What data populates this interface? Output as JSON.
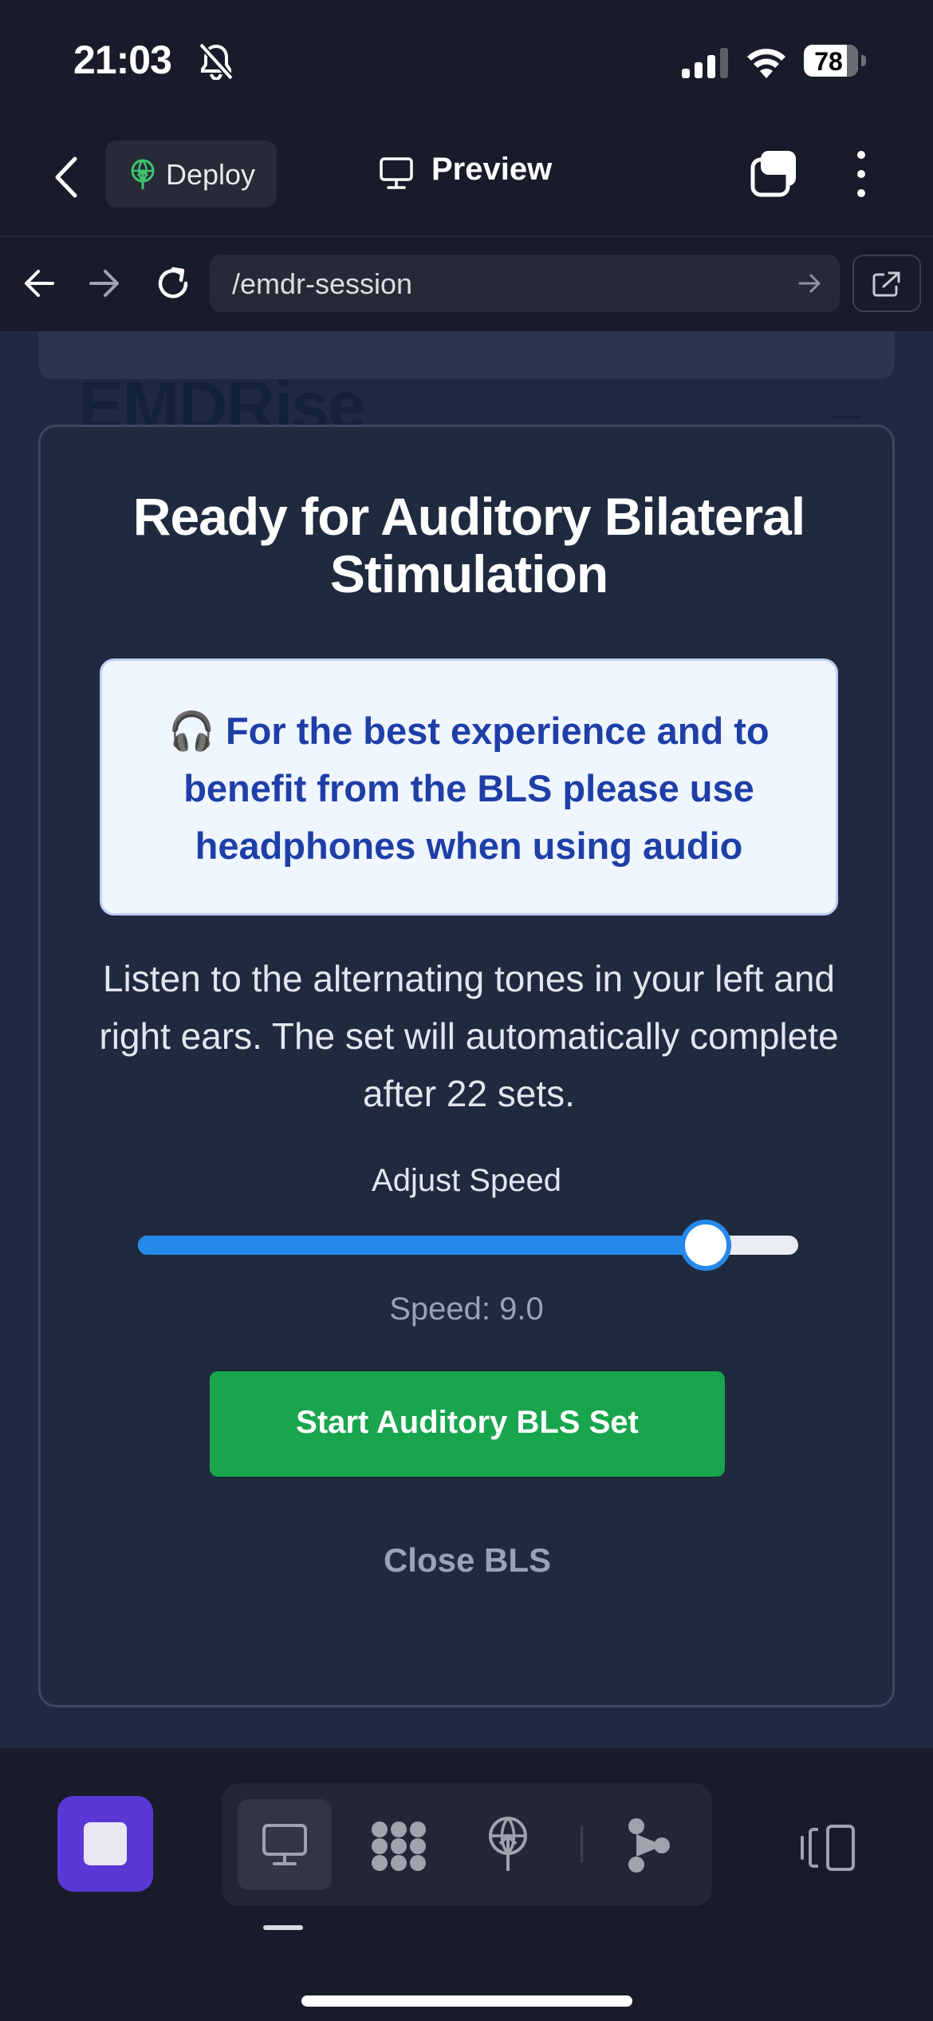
{
  "status_bar": {
    "time": "21:03",
    "battery": "78",
    "icons": [
      "bell-slash-icon",
      "signal-icon",
      "wifi-icon",
      "battery-icon"
    ]
  },
  "header": {
    "deploy_label": "Deploy",
    "preview_label": "Preview",
    "icons": [
      "chevron-left-icon",
      "deploy-icon",
      "monitor-icon",
      "tabs-icon",
      "kebab-icon"
    ]
  },
  "browser": {
    "url": "/emdr-session",
    "icons": [
      "arrow-left-icon",
      "arrow-right-icon",
      "reload-icon",
      "arrow-right-icon",
      "external-link-icon"
    ]
  },
  "background_page": {
    "title": "EMDRise"
  },
  "modal": {
    "title": "Ready for Auditory Bilateral Stimulation",
    "info_icon": "🎧",
    "info_text": "For the best experience and to benefit from the BLS please use headphones when using audio",
    "description": "Listen to the alternating tones in your left and right ears. The set will automatically complete after 22 sets.",
    "speed_label": "Adjust Speed",
    "speed_fraction": 0.86,
    "speed_value_text": "Speed: 9.0",
    "start_button": "Start Auditory BLS Set",
    "close_button": "Close BLS"
  },
  "bottom_toolbar": {
    "icons": [
      "stop-icon",
      "monitor-icon",
      "workflow-icon",
      "deploy-icon",
      "agent-icon",
      "panel-toggle-icon"
    ],
    "active": "monitor-icon"
  },
  "colors": {
    "accent_blue": "#2589ea",
    "start_green": "#18a54d",
    "stop_purple": "#5b38d6",
    "info_bg": "#eff6ff",
    "info_text": "#1e3ea8"
  }
}
